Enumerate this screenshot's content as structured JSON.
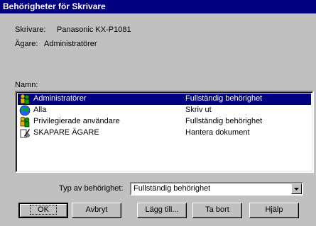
{
  "window": {
    "title": "Behörigheter för Skrivare"
  },
  "printer": {
    "label": "Skrivare:",
    "value": "Panasonic KX-P1081"
  },
  "owner": {
    "label": "Ägare:",
    "value": "Administratörer"
  },
  "list": {
    "label": "Namn:",
    "items": [
      {
        "name": "Administratörer",
        "permission": "Fullständig behörighet",
        "icon": "group-icon",
        "selected": true
      },
      {
        "name": "Alla",
        "permission": "Skriv ut",
        "icon": "globe-icon",
        "selected": false
      },
      {
        "name": "Privilegierade användare",
        "permission": "Fullständig behörighet",
        "icon": "group-icon",
        "selected": false
      },
      {
        "name": "SKAPARE ÄGARE",
        "permission": "Hantera dokument",
        "icon": "creator-owner-icon",
        "selected": false
      }
    ]
  },
  "access_type": {
    "label": "Typ av behörighet:",
    "value": "Fullständig behörighet"
  },
  "buttons": {
    "ok": "OK",
    "cancel": "Avbryt",
    "add": "Lägg till...",
    "remove": "Ta bort",
    "help": "Hjälp"
  },
  "colors": {
    "titlebar": "#000080",
    "selection": "#000080",
    "face": "#c0c0c0"
  }
}
